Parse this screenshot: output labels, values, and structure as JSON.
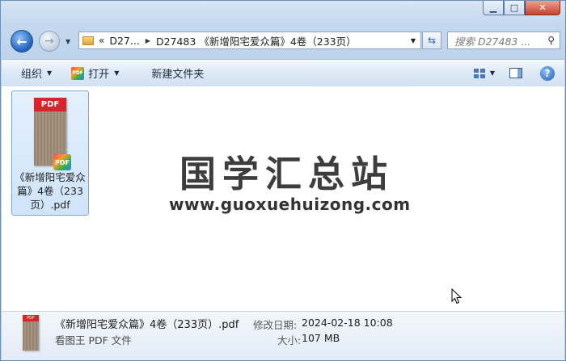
{
  "window": {
    "minimize_glyph": "▁",
    "maximize_glyph": "□",
    "close_glyph": "✕"
  },
  "nav": {
    "back_glyph": "←",
    "forward_glyph": "→"
  },
  "address": {
    "overflow": "«",
    "crumbs": [
      "D27...",
      "D27483 《新增阳宅爱众篇》4卷（233页）"
    ]
  },
  "search": {
    "placeholder": "搜索 D27483 ..."
  },
  "toolbar": {
    "organize": "组织",
    "open": "打开",
    "new_folder": "新建文件夹"
  },
  "file": {
    "thumb_label": "PDF",
    "badge_label": "PDF",
    "name": "《新增阳宅爱众篇》4卷（233页）.pdf"
  },
  "watermark": {
    "title": "国学汇总站",
    "url": "www.guoxuehuizong.com"
  },
  "details": {
    "thumb_label": "PDF",
    "name": "《新增阳宅爱众篇》4卷（233页）.pdf",
    "type": "看图王 PDF 文件",
    "modified_label": "修改日期:",
    "modified_value": "2024-02-18 10:08",
    "size_label": "大小:",
    "size_value": "107 MB"
  }
}
